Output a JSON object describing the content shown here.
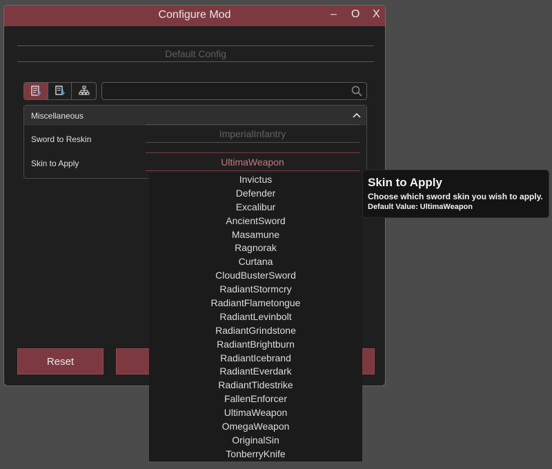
{
  "window": {
    "title": "Configure Mod",
    "minimize_label": "–",
    "maximize_label": "O",
    "close_label": "X"
  },
  "config_header": "Default Config",
  "toolbar": {
    "tabs": [
      "document-edit-icon",
      "document-download-icon",
      "hierarchy-icon"
    ],
    "search_placeholder": ""
  },
  "section": {
    "title": "Miscellaneous",
    "rows": [
      {
        "label": "Sword to Reskin",
        "value": "ImperialInfantry"
      },
      {
        "label": "Skin to Apply",
        "value": "UltimaWeapon"
      }
    ]
  },
  "dropdown_options": [
    "Invictus",
    "Defender",
    "Excalibur",
    "AncientSword",
    "Masamune",
    "Ragnorak",
    "Curtana",
    "CloudBusterSword",
    "RadiantStormcry",
    "RadiantFlametongue",
    "RadiantLevinbolt",
    "RadiantGrindstone",
    "RadiantBrightburn",
    "RadiantIcebrand",
    "RadiantEverdark",
    "RadiantTidestrike",
    "FallenEnforcer",
    "UltimaWeapon",
    "OmegaWeapon",
    "OriginalSin",
    "TonberryKnife"
  ],
  "buttons": {
    "reset_label": "Reset",
    "second_label": ""
  },
  "tooltip": {
    "title": "Skin to Apply",
    "description": "Choose which sword skin you wish to apply.",
    "default_value": "Default Value:  UltimaWeapon"
  },
  "colors": {
    "accent": "#7c3a40",
    "panel": "#1f1f1f",
    "desktop": "#4b4b4b"
  }
}
